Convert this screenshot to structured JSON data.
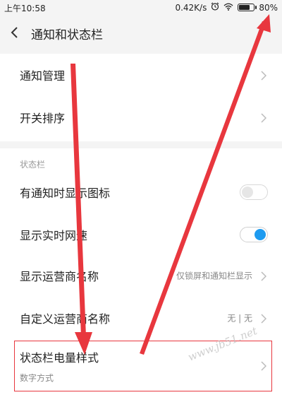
{
  "status_bar": {
    "time": "上午10:58",
    "net_speed": "0.42K/s",
    "battery": "80%",
    "battery_level": 0.8
  },
  "header": {
    "title": "通知和状态栏"
  },
  "list": {
    "notification_mgmt": "通知管理",
    "switch_order": "开关排序",
    "status_section": "状态栏",
    "show_icon_on_notify": "有通知时显示图标",
    "show_icon_on_notify_state": "off",
    "show_net_speed": "显示实时网速",
    "show_net_speed_state": "on",
    "show_carrier_name": "显示运营商名称",
    "show_carrier_name_value": "仅锁屏和通知栏显示",
    "custom_carrier_name": "自定义运营商名称",
    "custom_carrier_name_value": "无 | 无",
    "battery_style": "状态栏电量样式",
    "battery_style_value": "数字方式"
  },
  "colors": {
    "accent": "#1e9bf0",
    "annotation": "#e8373e"
  },
  "watermark": "www.jb51.net"
}
